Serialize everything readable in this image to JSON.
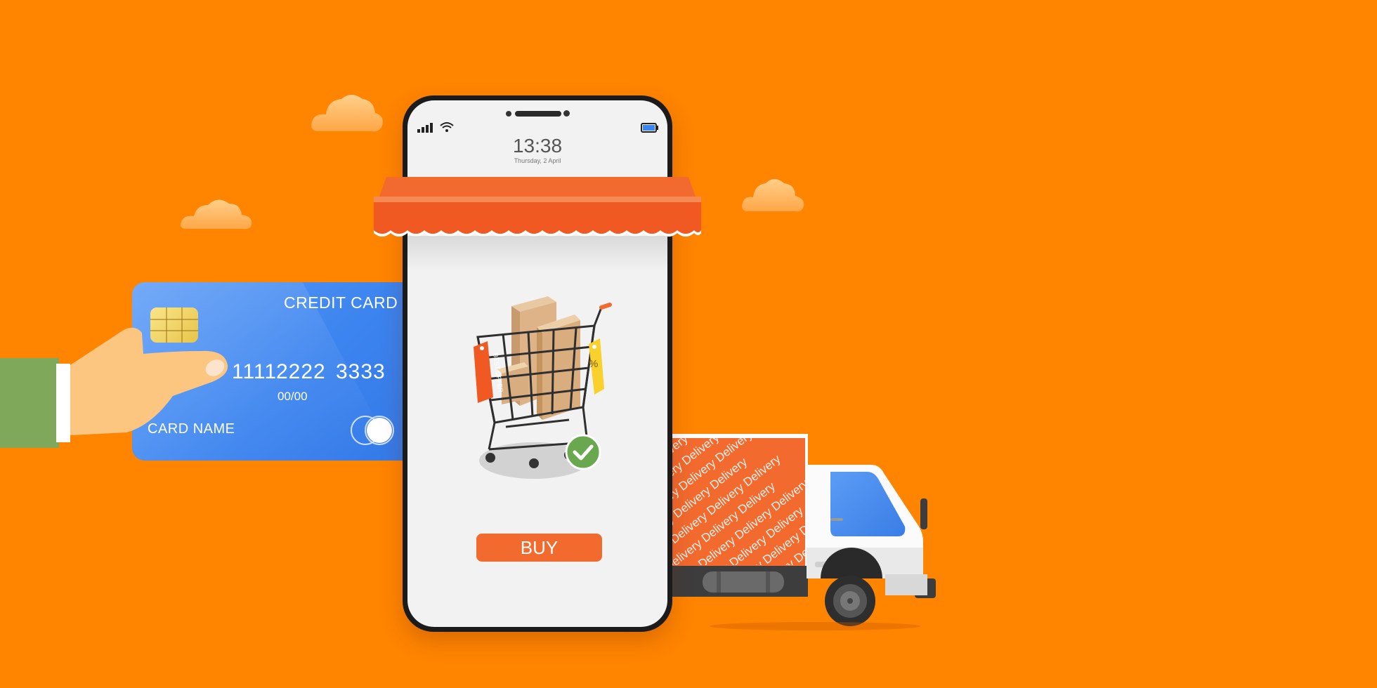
{
  "phone": {
    "time": "13:38",
    "date": "Thursday, 2 April",
    "buy_label": "BUY",
    "status_icons": [
      "signal-icon",
      "wifi-icon",
      "battery-icon"
    ]
  },
  "credit_card": {
    "title": "CREDIT CARD",
    "number_groups": [
      "1111",
      "2222",
      "3333"
    ],
    "expiry": "00/00",
    "card_name": "CARD NAME"
  },
  "cart": {
    "tag_best_offer": "BEST OFFER",
    "tag_percent": "%"
  },
  "truck": {
    "repeat_text": "Delivery"
  },
  "colors": {
    "background": "#ff8400",
    "accent": "#f26a2e",
    "card_blue": "#3c84ef",
    "check_green": "#6aa84f"
  }
}
